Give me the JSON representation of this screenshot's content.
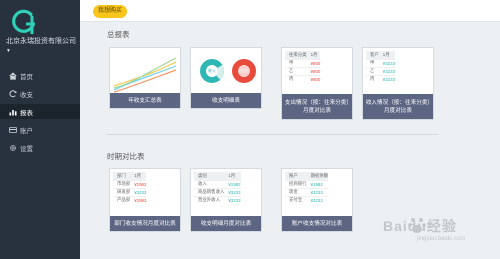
{
  "app": {
    "company": "北京永瑞投资有限公司",
    "colors": {
      "sidebar": "#28323f",
      "accent": "#f7c51c",
      "card_footer": "#5c6682",
      "negative": "#e84b3c",
      "positive": "#2fb7b4"
    }
  },
  "nav": [
    {
      "label": "首页",
      "icon": "home-icon"
    },
    {
      "label": "收支",
      "icon": "refresh-icon"
    },
    {
      "label": "报表",
      "icon": "chart-icon",
      "active": true
    },
    {
      "label": "账户",
      "icon": "card-icon"
    },
    {
      "label": "设置",
      "icon": "gear-icon"
    }
  ],
  "toolbar": {
    "my_button": "我想购买"
  },
  "summary": {
    "title": "总报表",
    "cards": {
      "trend": {
        "label": "年收支汇总表"
      },
      "pies": {
        "label": "收支明细表",
        "income_text": "收入",
        "expense_text": "支出"
      },
      "expense_month": {
        "label": "支出情况（按：往来分类）月度对比表",
        "head": [
          "往来分类",
          "1月"
        ],
        "rows": [
          [
            "甲",
            "¥800"
          ],
          [
            "乙",
            "¥800"
          ],
          [
            "丙",
            "¥800"
          ]
        ]
      },
      "income_month": {
        "label": "收入情况（按：往来分类）月度对比表",
        "head": [
          "客户",
          "1月"
        ],
        "rows": [
          [
            "甲",
            "¥3233"
          ],
          [
            "乙",
            "¥3233"
          ],
          [
            "丙",
            "¥3233"
          ]
        ]
      }
    }
  },
  "period": {
    "title": "时期对比表",
    "cards": {
      "dept": {
        "label": "部门收支情况月度对比表",
        "head": [
          "部门",
          "1月"
        ],
        "rows": [
          [
            "市场部",
            "¥1982"
          ],
          [
            "研发部",
            "¥3233"
          ],
          [
            "产品部",
            "¥1982"
          ]
        ]
      },
      "detail": {
        "label": "收支明细月度对比表",
        "head": [
          "类别",
          "1月"
        ],
        "rows": [
          [
            "收入",
            "¥1982"
          ],
          [
            "商品销售收入",
            "¥3233"
          ],
          [
            "营业外收入",
            "¥3233"
          ]
        ]
      },
      "account": {
        "label": "账户收支情况对比表",
        "head": [
          "账户",
          "期初余额"
        ],
        "rows": [
          [
            "招商银行",
            "¥1982"
          ],
          [
            "现金",
            "¥3233"
          ],
          [
            "支付宝",
            "¥3233"
          ]
        ]
      }
    }
  },
  "watermark": {
    "text": "Baidu经验",
    "url": "jingyan.baidu.com"
  }
}
